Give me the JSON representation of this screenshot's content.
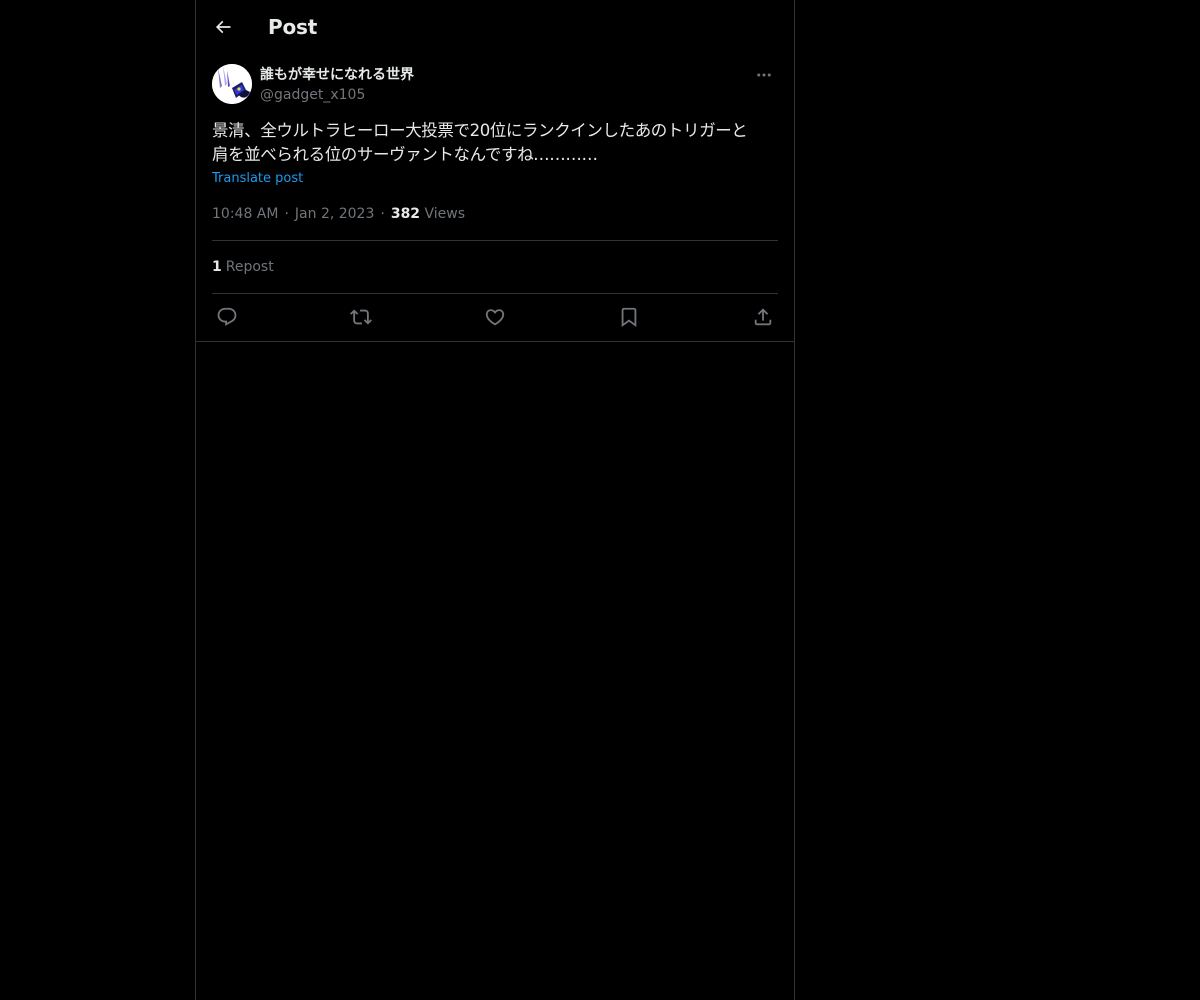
{
  "header": {
    "title": "Post",
    "back_icon": "arrow-left-icon"
  },
  "post": {
    "author_name": "誰もが幸せになれる世界",
    "author_handle": "@gadget_x105",
    "text": "景清、全ウルトラヒーロー大投票で20位にランクインしたあのトリガーと\n肩を並べられる位のサーヴァントなんですね…………",
    "translate_label": "Translate post",
    "time": "10:48 AM",
    "date": "Jan 2, 2023",
    "separator": "·",
    "views_count": "382",
    "views_label": "Views",
    "repost_count": "1",
    "repost_label": "Repost"
  },
  "actions": [
    {
      "name": "reply",
      "icon": "reply-icon"
    },
    {
      "name": "repost",
      "icon": "repost-icon"
    },
    {
      "name": "like",
      "icon": "heart-icon"
    },
    {
      "name": "bookmark",
      "icon": "bookmark-icon"
    },
    {
      "name": "share",
      "icon": "share-icon"
    }
  ],
  "colors": {
    "background": "#000000",
    "text_primary": "#e7e9ea",
    "text_secondary": "#71767b",
    "accent": "#1d9bf0",
    "border": "#2f3336"
  }
}
